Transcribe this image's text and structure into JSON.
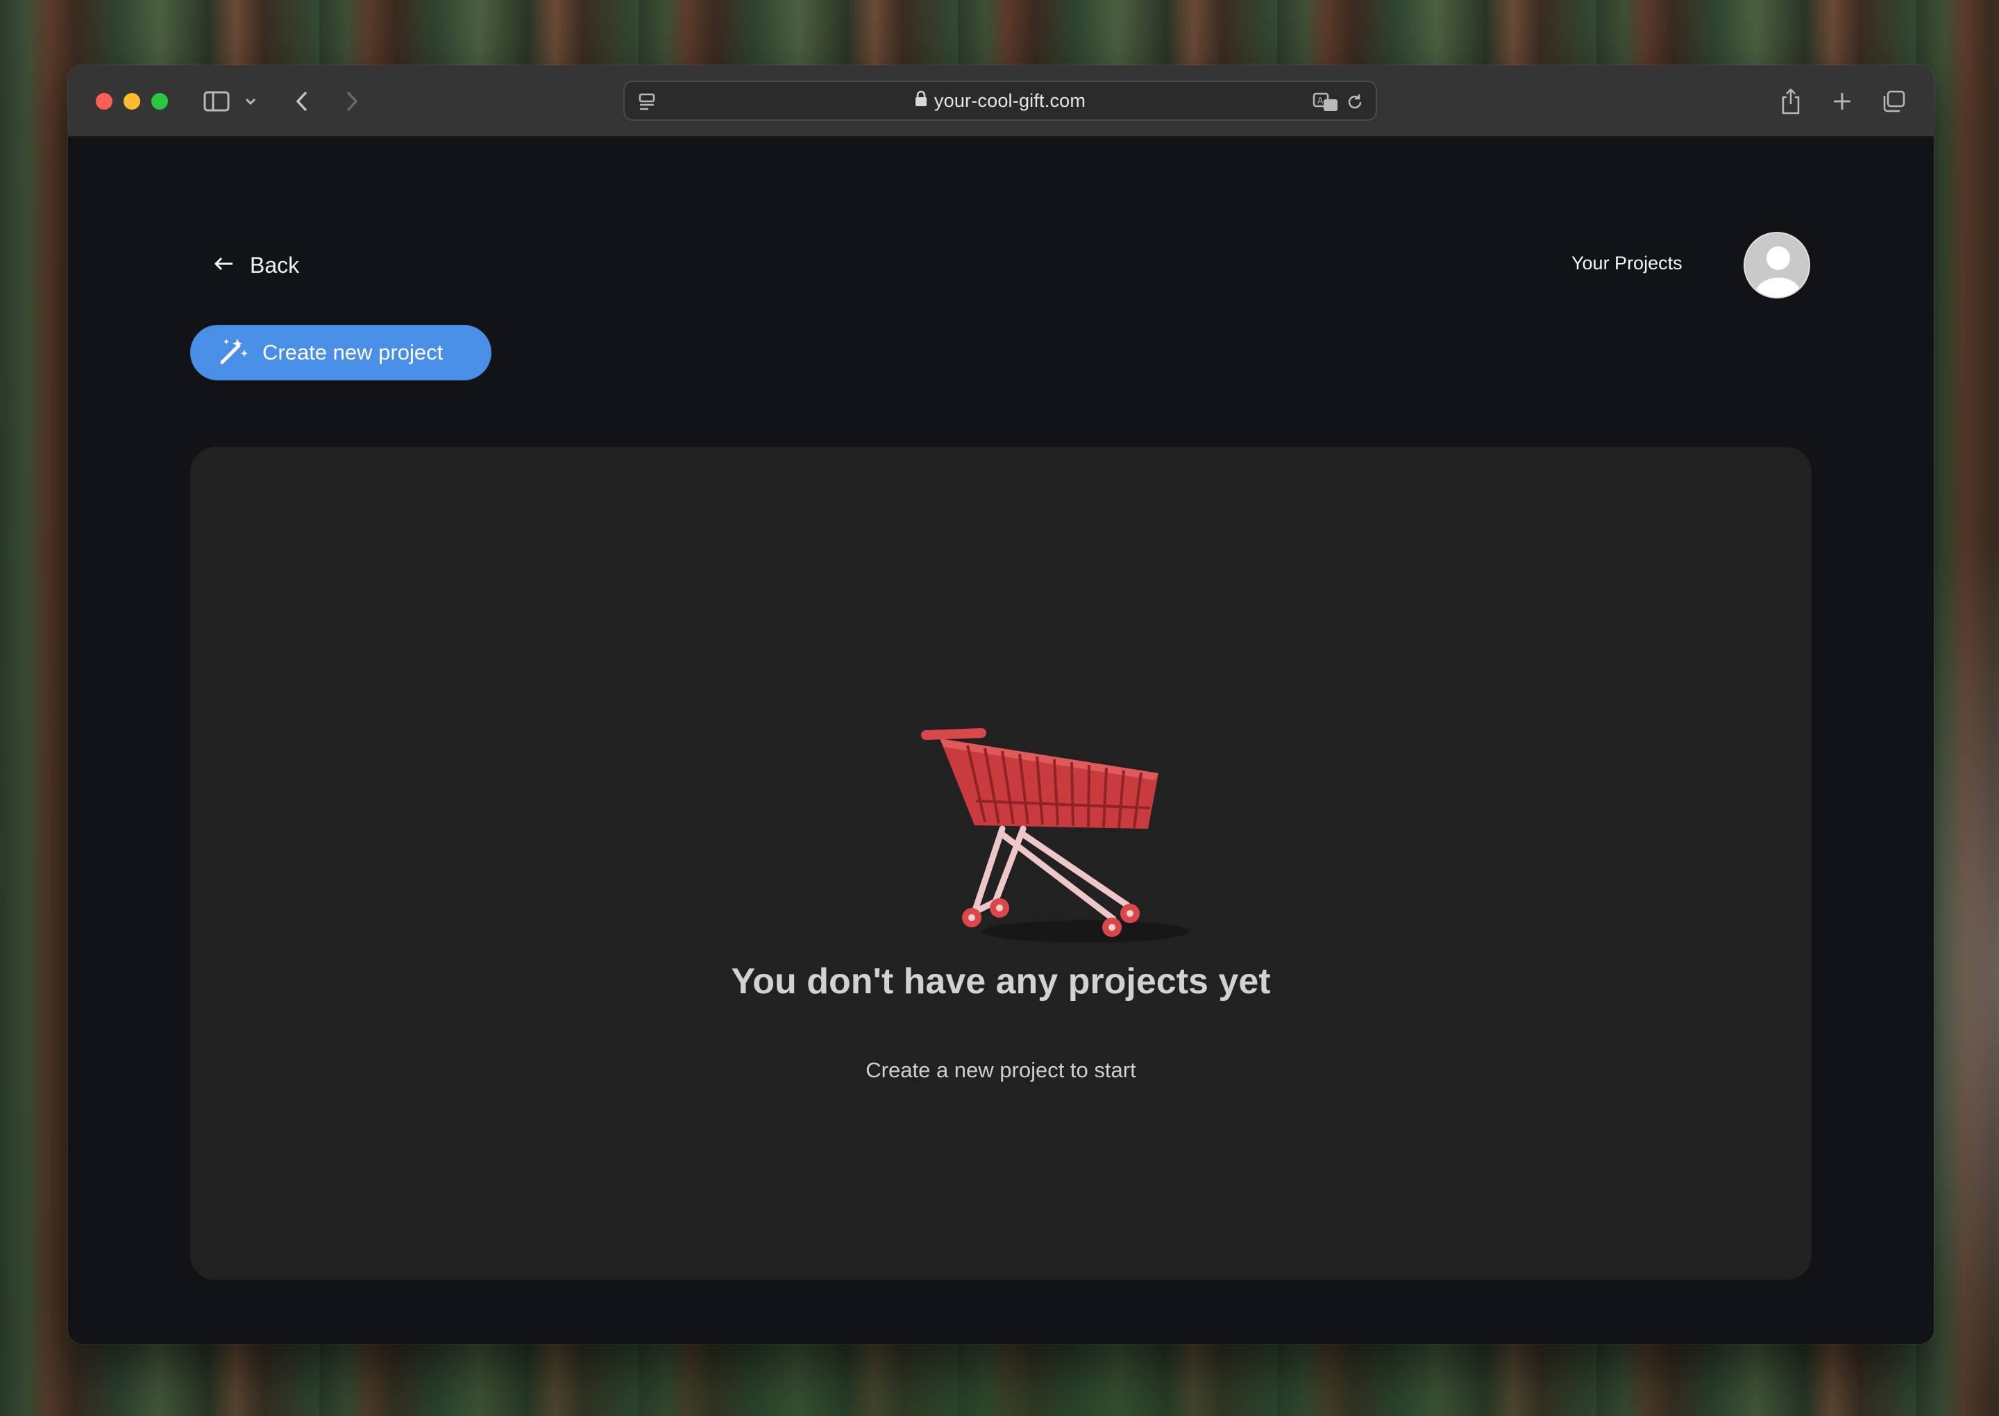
{
  "browser": {
    "url": "your-cool-gift.com",
    "traffic_lights": {
      "close": "#ff5f57",
      "minimize": "#febc2e",
      "zoom": "#28c840"
    },
    "icons": [
      "sidebar-icon",
      "chevron-down-icon",
      "back-icon",
      "forward-icon",
      "reader-icon",
      "lock-icon",
      "translate-icon",
      "reload-icon",
      "share-icon",
      "new-tab-icon",
      "tabs-overview-icon"
    ]
  },
  "header": {
    "back_label": "Back",
    "nav_label": "Your Projects"
  },
  "actions": {
    "create_label": "Create new project"
  },
  "empty_state": {
    "title": "You don't have any projects yet",
    "subtitle": "Create a new project to start",
    "illustration": "shopping-cart"
  },
  "colors": {
    "accent": "#4a8fe7",
    "page_bg": "#121316",
    "card_bg": "#212121",
    "cart_red": "#d9474a"
  }
}
